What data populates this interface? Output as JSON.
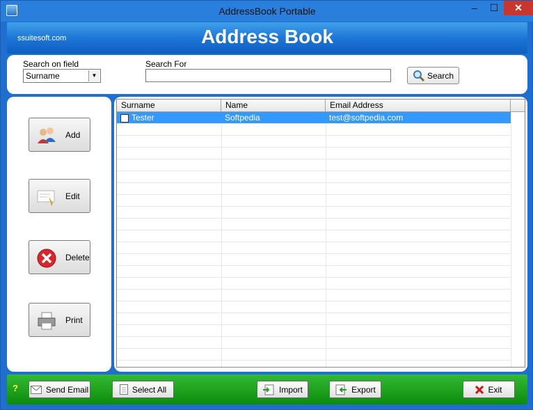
{
  "window": {
    "title": "AddressBook Portable",
    "minimize_label": "–",
    "maximize_label": "☐",
    "close_label": "✕"
  },
  "banner": {
    "brand_link": "ssuitesoft.com",
    "title": "Address Book"
  },
  "search": {
    "field_label": "Search on field",
    "field_value": "Surname",
    "for_label": "Search For",
    "for_value": "",
    "button_label": "Search"
  },
  "sidebar": {
    "add_label": "Add",
    "edit_label": "Edit",
    "delete_label": "Delete",
    "print_label": "Print"
  },
  "table": {
    "columns": [
      "Surname",
      "Name",
      "Email Address"
    ],
    "rows": [
      {
        "surname": "Tester",
        "name": "Softpedia",
        "email": "test@softpedia.com",
        "selected": true
      }
    ]
  },
  "bottom": {
    "help_label": "?",
    "send_email_label": "Send Email",
    "select_all_label": "Select All",
    "import_label": "Import",
    "export_label": "Export",
    "exit_label": "Exit"
  }
}
